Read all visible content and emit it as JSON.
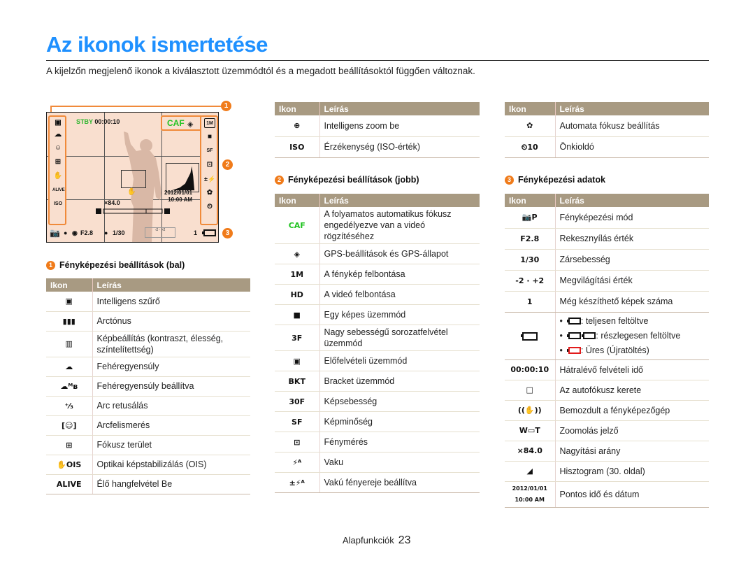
{
  "page": {
    "title": "Az ikonok ismertetése",
    "intro": "A kijelzőn megjelenő ikonok a kiválasztott üzemmódtól és a megadott beállításoktól függően változnak.",
    "footer_section": "Alapfunkciók",
    "footer_page": "23"
  },
  "screen": {
    "stby": "STBY",
    "time": "00:00:10",
    "caf": "CAF",
    "date": "2012/01/01",
    "clock": "10:00 AM",
    "zoom_ratio": "×84.0",
    "aperture": "F2.8",
    "shutter": "1/30",
    "shots": "1",
    "callouts": [
      "1",
      "2",
      "3"
    ]
  },
  "colors": {
    "title": "#1e90ff",
    "header_bg": "#a89a82",
    "callout": "#f07b1a",
    "screen_bg": "#f9dfcf",
    "caf_green": "#22c322"
  },
  "left": {
    "number": "1",
    "heading": "Fényképezési beállítások (bal)",
    "col_icon": "Ikon",
    "col_desc": "Leírás",
    "rows": [
      {
        "icon": "smart-filter-icon",
        "glyph": "▣",
        "desc": "Intelligens szűrő"
      },
      {
        "icon": "face-tone-icon",
        "glyph": "▮▮▮",
        "desc": "Arctónus"
      },
      {
        "icon": "image-adjust-icon",
        "glyph": "▥",
        "desc": "Képbeállítás (kontraszt, élesség, színtelítettség)"
      },
      {
        "icon": "white-balance-icon",
        "glyph": "☁",
        "desc": "Fehéregyensúly"
      },
      {
        "icon": "white-balance-custom-icon",
        "glyph": "☁ᴹʙ",
        "desc": "Fehéregyensúly beállítva"
      },
      {
        "icon": "face-retouch-icon",
        "glyph": "⁺⁄₃",
        "desc": "Arc retusálás"
      },
      {
        "icon": "face-detection-icon",
        "glyph": "[☺]",
        "desc": "Arcfelismerés"
      },
      {
        "icon": "focus-area-icon",
        "glyph": "⊞",
        "desc": "Fókusz terület"
      },
      {
        "icon": "ois-icon",
        "glyph": "✋OIS",
        "desc": "Optikai képstabilizálás (OIS)"
      },
      {
        "icon": "live-sound-icon",
        "glyph": "ALIVE",
        "desc": "Élő hangfelvétel Be"
      }
    ]
  },
  "middle_top": {
    "col_icon": "Ikon",
    "col_desc": "Leírás",
    "rows": [
      {
        "icon": "smart-zoom-icon",
        "glyph": "⊕",
        "desc": "Intelligens zoom be"
      },
      {
        "icon": "iso-icon",
        "glyph": "ISO",
        "desc": "Érzékenység (ISO-érték)"
      }
    ]
  },
  "middle": {
    "number": "2",
    "heading": "Fényképezési beállítások (jobb)",
    "col_icon": "Ikon",
    "col_desc": "Leírás",
    "rows": [
      {
        "icon": "caf-icon",
        "glyph": "CAF",
        "desc": "A folyamatos automatikus fókusz engedélyezve van a videó rögzítéséhez"
      },
      {
        "icon": "gps-icon",
        "glyph": "◈",
        "desc": "GPS-beállítások és GPS-állapot"
      },
      {
        "icon": "photo-resolution-icon",
        "glyph": "1M",
        "desc": "A fénykép felbontása"
      },
      {
        "icon": "video-resolution-icon",
        "glyph": "HD",
        "desc": "A videó felbontása"
      },
      {
        "icon": "single-shot-icon",
        "glyph": "■",
        "desc": "Egy képes üzemmód"
      },
      {
        "icon": "burst-icon",
        "glyph": "3F",
        "desc": "Nagy sebességű sorozatfelvétel üzemmód"
      },
      {
        "icon": "pre-capture-icon",
        "glyph": "▣",
        "desc": "Előfelvételi üzemmód"
      },
      {
        "icon": "bracket-icon",
        "glyph": "BKT",
        "desc": "Bracket üzemmód"
      },
      {
        "icon": "frame-rate-icon",
        "glyph": "30F",
        "desc": "Képsebesség"
      },
      {
        "icon": "quality-icon",
        "glyph": "SF",
        "desc": "Képminőség"
      },
      {
        "icon": "metering-icon",
        "glyph": "⊡",
        "desc": "Fénymérés"
      },
      {
        "icon": "flash-icon",
        "glyph": "⚡ᴬ",
        "desc": "Vaku"
      },
      {
        "icon": "flash-ev-icon",
        "glyph": "±⚡ᴬ",
        "desc": "Vakú fényereje beállítva"
      }
    ]
  },
  "right_top": {
    "col_icon": "Ikon",
    "col_desc": "Leírás",
    "rows": [
      {
        "icon": "macro-icon",
        "glyph": "✿",
        "desc": "Automata fókusz beállítás"
      },
      {
        "icon": "self-timer-icon",
        "glyph": "⏲10",
        "desc": "Önkioldó"
      }
    ]
  },
  "right": {
    "number": "3",
    "heading": "Fényképezési adatok",
    "col_icon": "Ikon",
    "col_desc": "Leírás",
    "rows": [
      {
        "icon": "shooting-mode-icon",
        "glyph": "📷P",
        "desc": "Fényképezési mód"
      },
      {
        "icon": "aperture-icon",
        "glyph": "F2.8",
        "desc": "Rekesznyílás érték"
      },
      {
        "icon": "shutter-icon",
        "glyph": "1/30",
        "desc": "Zársebesség"
      },
      {
        "icon": "exposure-icon",
        "glyph": "-2 · +2",
        "desc": "Megvilágítási érték"
      },
      {
        "icon": "shots-remaining-icon",
        "glyph": "1",
        "desc": "Még készíthető képek száma"
      }
    ],
    "battery": {
      "full": ": teljesen feltöltve",
      "partial": ": részlegesen feltöltve",
      "empty": ": Üres (Újratöltés)"
    },
    "rows2": [
      {
        "icon": "record-time-icon",
        "glyph": "00:00:10",
        "desc": "Hátralévő felvételi idő"
      },
      {
        "icon": "af-frame-icon",
        "glyph": "□",
        "desc": "Az autofókusz kerete"
      },
      {
        "icon": "shake-icon",
        "glyph": "((✋))",
        "desc": "Bemozdult a fényképezőgép"
      },
      {
        "icon": "zoom-bar-icon",
        "glyph": "W▭T",
        "desc": "Zoomolás jelző"
      },
      {
        "icon": "zoom-ratio-icon",
        "glyph": "×84.0",
        "desc": "Nagyítási arány"
      },
      {
        "icon": "histogram-icon",
        "glyph": "◢",
        "desc": "Hisztogram (30. oldal)"
      },
      {
        "icon": "datetime-icon",
        "glyph": "2012/01/01 10:00 AM",
        "desc": "Pontos idő és dátum"
      }
    ]
  }
}
